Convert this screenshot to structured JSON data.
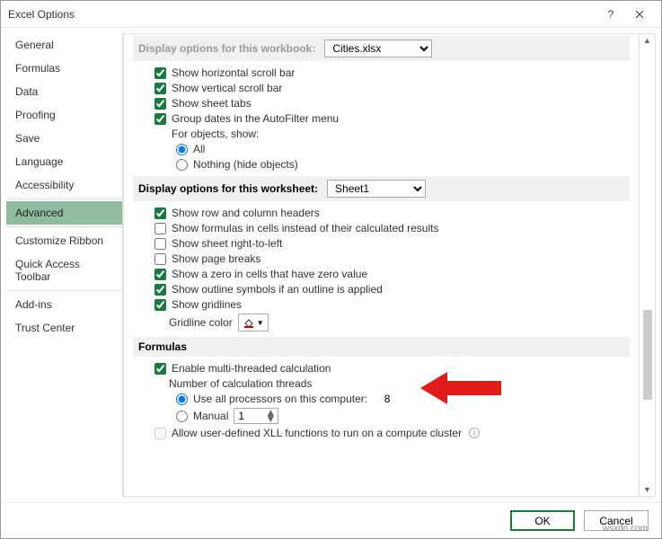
{
  "title": "Excel Options",
  "sidebar": {
    "items": [
      "General",
      "Formulas",
      "Data",
      "Proofing",
      "Save",
      "Language",
      "Accessibility",
      "Advanced",
      "Customize Ribbon",
      "Quick Access Toolbar",
      "Add-ins",
      "Trust Center"
    ],
    "selected": "Advanced"
  },
  "cutHeader": {
    "label": "Display options for this workbook:",
    "value": "Cities.xlsx"
  },
  "workbookOpts": {
    "hscroll": "Show horizontal scroll bar",
    "vscroll": "Show vertical scroll bar",
    "tabs": "Show sheet tabs",
    "groupdates": "Group dates in the AutoFilter menu",
    "forObjects": "For objects, show:",
    "all": "All",
    "nothing": "Nothing (hide objects)"
  },
  "wsHeader": {
    "label": "Display options for this worksheet:",
    "value": "Sheet1"
  },
  "wsOpts": {
    "headers": "Show row and column headers",
    "formulas": "Show formulas in cells instead of their calculated results",
    "rtl": "Show sheet right-to-left",
    "pagebreaks": "Show page breaks",
    "zero": "Show a zero in cells that have zero value",
    "outline": "Show outline symbols if an outline is applied",
    "gridlines": "Show gridlines",
    "gridcolor": "Gridline color"
  },
  "formHeader": "Formulas",
  "formOpts": {
    "mt": "Enable multi-threaded calculation",
    "threads": "Number of calculation threads",
    "allproc": "Use all processors on this computer:",
    "procnum": "8",
    "manual": "Manual",
    "manualval": "1",
    "xll": "Allow user-defined XLL functions to run on a compute cluster"
  },
  "buttons": {
    "ok": "OK",
    "cancel": "Cancel"
  },
  "watermark": "wsxdn.com"
}
